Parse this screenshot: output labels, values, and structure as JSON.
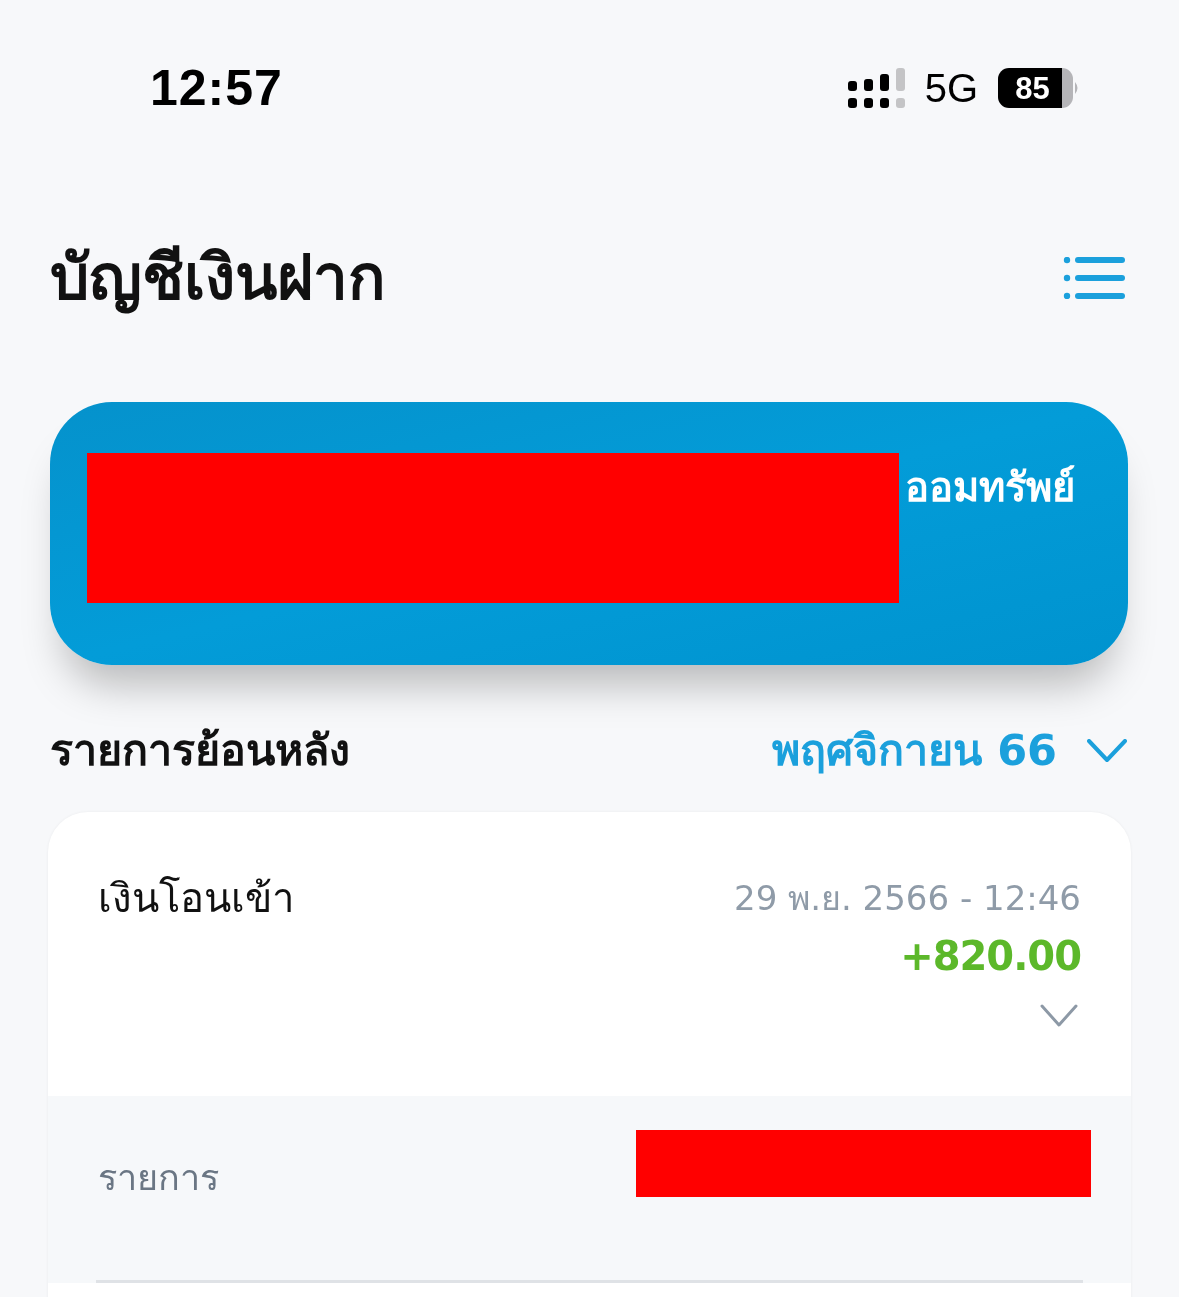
{
  "status_bar": {
    "time": "12:57",
    "network": "5G",
    "battery": "85"
  },
  "header": {
    "title": "บัญชีเงินฝาก"
  },
  "account_card": {
    "account_type": "ออมทรัพย์"
  },
  "history": {
    "title": "รายการย้อนหลัง",
    "month": "พฤศจิกายน 66"
  },
  "transactions": [
    {
      "title": "เงินโอนเข้า",
      "datetime": "29 พ.ย. 2566 - 12:46",
      "amount": "+820.00",
      "expanded": true,
      "details": [
        {
          "label": "รายการ"
        }
      ]
    }
  ]
}
